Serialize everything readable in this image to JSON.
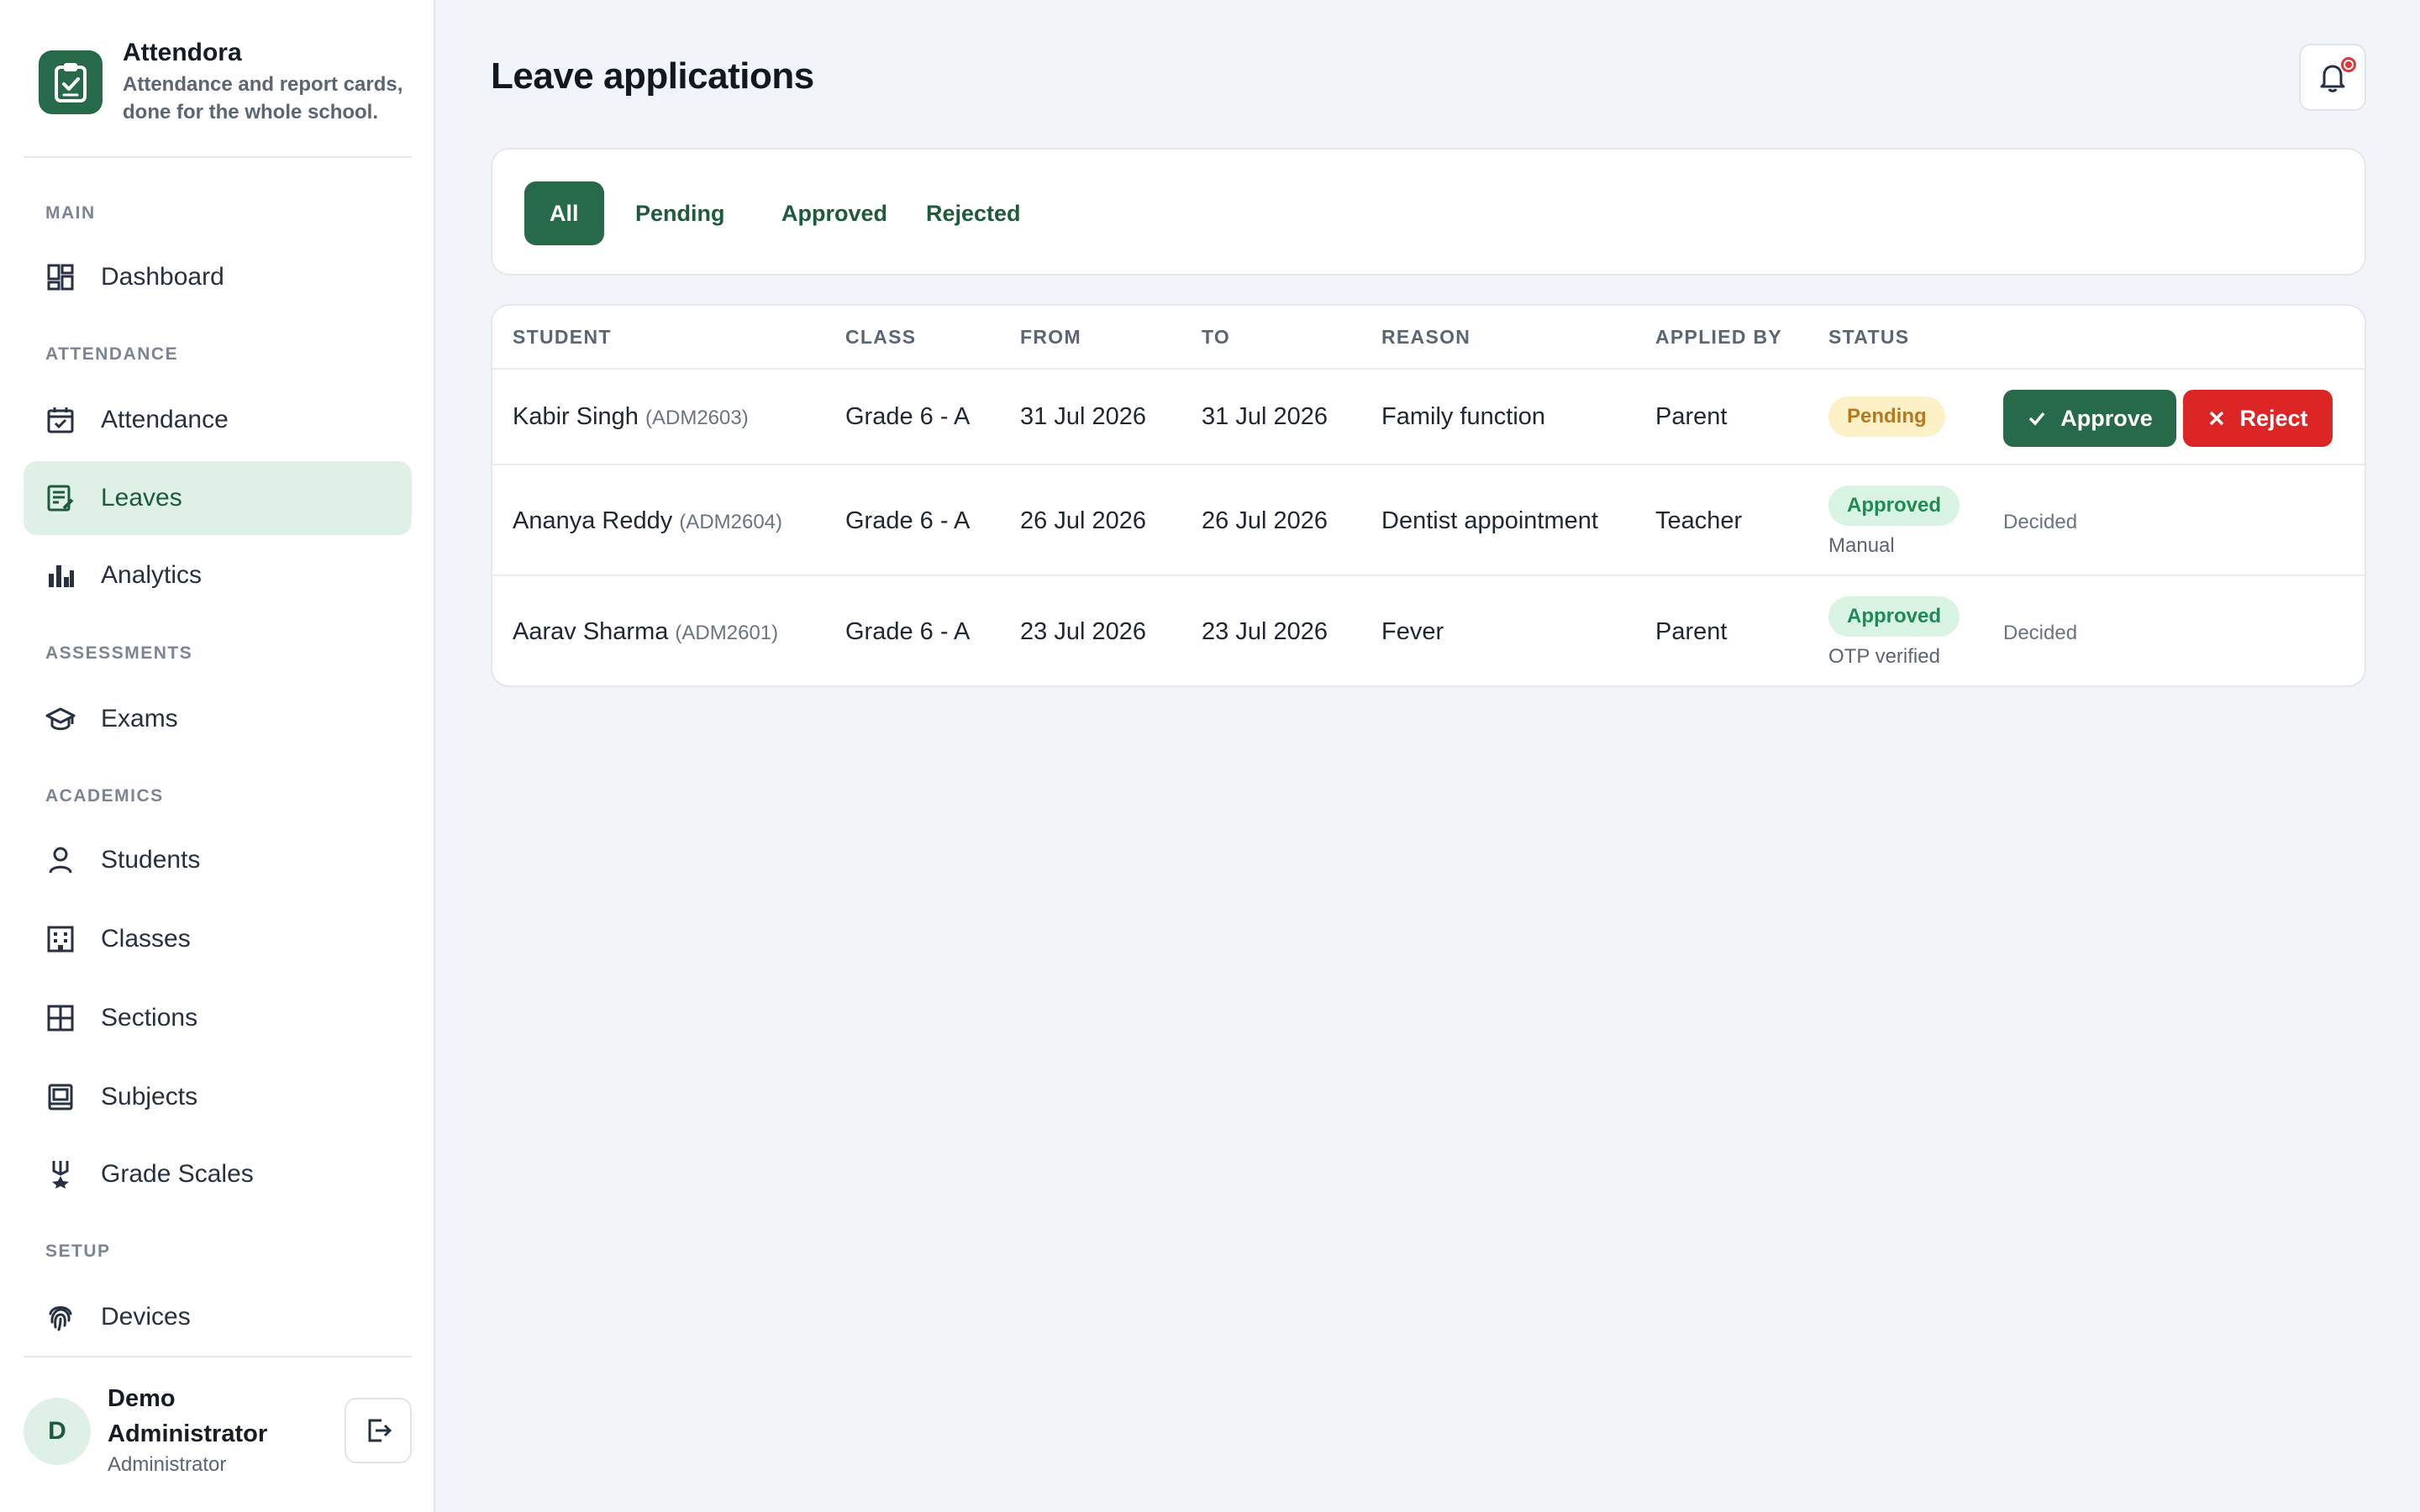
{
  "sidebar": {
    "brand": {
      "name": "Attendora",
      "tagline": "Attendance and report cards, done for the whole school.",
      "logo_icon": "clipboard-check-icon"
    },
    "sections": [
      {
        "label": "MAIN"
      },
      {
        "label": "ATTENDANCE"
      },
      {
        "label": "ASSESSMENTS"
      },
      {
        "label": "ACADEMICS"
      },
      {
        "label": "SETUP"
      }
    ],
    "items": [
      {
        "label": "Dashboard",
        "icon": "dashboard-icon"
      },
      {
        "label": "Attendance",
        "icon": "calendar-check-icon"
      },
      {
        "label": "Leaves",
        "icon": "leave-form-icon",
        "active": true
      },
      {
        "label": "Analytics",
        "icon": "bar-chart-icon"
      },
      {
        "label": "Exams",
        "icon": "graduation-cap-icon"
      },
      {
        "label": "Students",
        "icon": "user-icon"
      },
      {
        "label": "Classes",
        "icon": "building-icon"
      },
      {
        "label": "Sections",
        "icon": "grid-icon"
      },
      {
        "label": "Subjects",
        "icon": "book-icon"
      },
      {
        "label": "Grade Scales",
        "icon": "medal-icon"
      },
      {
        "label": "Devices",
        "icon": "fingerprint-icon"
      }
    ],
    "user": {
      "initial": "D",
      "name": "Demo Administrator",
      "role": "Administrator",
      "logout_icon": "logout-icon"
    }
  },
  "header": {
    "title": "Leave applications",
    "notification_icon": "bell-icon"
  },
  "filters": [
    {
      "label": "All",
      "active": true
    },
    {
      "label": "Pending"
    },
    {
      "label": "Approved"
    },
    {
      "label": "Rejected"
    }
  ],
  "table": {
    "columns": [
      "STUDENT",
      "CLASS",
      "FROM",
      "TO",
      "REASON",
      "APPLIED BY",
      "STATUS"
    ],
    "rows": [
      {
        "student": "Kabir Singh",
        "adm": "(ADM2603)",
        "class": "Grade 6 - A",
        "from": "31 Jul 2026",
        "to": "31 Jul 2026",
        "reason": "Family function",
        "applied_by": "Parent",
        "status": "Pending",
        "status_note": "",
        "approve_label": "Approve",
        "reject_label": "Reject"
      },
      {
        "student": "Ananya Reddy",
        "adm": "(ADM2604)",
        "class": "Grade 6 - A",
        "from": "26 Jul 2026",
        "to": "26 Jul 2026",
        "reason": "Dentist appointment",
        "applied_by": "Teacher",
        "status": "Approved",
        "status_note": "Manual",
        "action": "Decided"
      },
      {
        "student": "Aarav Sharma",
        "adm": "(ADM2601)",
        "class": "Grade 6 - A",
        "from": "23 Jul 2026",
        "to": "23 Jul 2026",
        "reason": "Fever",
        "applied_by": "Parent",
        "status": "Approved",
        "status_note": "OTP verified",
        "action": "Decided"
      }
    ]
  },
  "colors": {
    "accent": "#276a4a",
    "active_nav_bg": "#dff1e6",
    "pending_bg": "#fdf1c7",
    "pending_text": "#b7791f",
    "approved_bg": "#d9f4e3",
    "approved_text": "#1f8a55",
    "reject": "#dc2626"
  }
}
